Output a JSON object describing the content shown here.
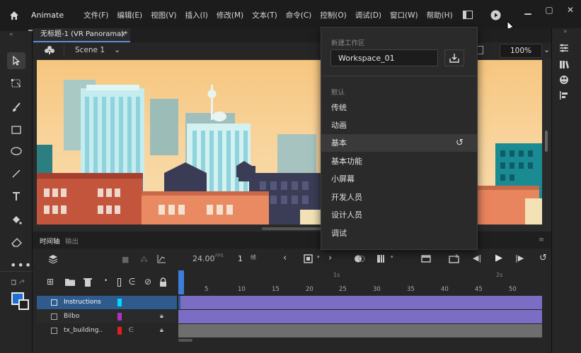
{
  "app": {
    "name": "Animate"
  },
  "menu": [
    "文件(F)",
    "编辑(E)",
    "视图(V)",
    "插入(I)",
    "修改(M)",
    "文本(T)",
    "命令(C)",
    "控制(O)",
    "调试(D)",
    "窗口(W)",
    "帮助(H)"
  ],
  "document": {
    "tab_title": "无标题-1 (VR Panorama)*",
    "close": "×",
    "scene": "Scene 1",
    "zoom": "100%"
  },
  "timeline": {
    "tabs": [
      "时间轴",
      "输出"
    ],
    "fps": "24.00",
    "fps_unit": "FPS",
    "frame": "1",
    "frame_unit": "帧",
    "seconds_marks": [
      "1s",
      "2s"
    ],
    "frame_ticks": [
      "5",
      "10",
      "15",
      "20",
      "25",
      "30",
      "35",
      "40",
      "45",
      "50"
    ],
    "layers": [
      {
        "name": "Instructions",
        "color": "#00d8ff",
        "selected": true
      },
      {
        "name": "Bilbo",
        "color": "#b030c0",
        "selected": false
      },
      {
        "name": "tx_building..",
        "color": "#e02020",
        "selected": false
      }
    ]
  },
  "workspace_menu": {
    "new_label": "新建工作区",
    "input_value": "Workspace_01",
    "default_label": "默认",
    "items": [
      "传统",
      "动画",
      "基本",
      "基本功能",
      "小屏幕",
      "开发人员",
      "设计人员",
      "调试"
    ],
    "selected": "基本"
  },
  "colors": {
    "accent": "#3d7fd8",
    "stroke_swatch": "#1f6fd0",
    "layer_frames": "#7b6cc4"
  }
}
